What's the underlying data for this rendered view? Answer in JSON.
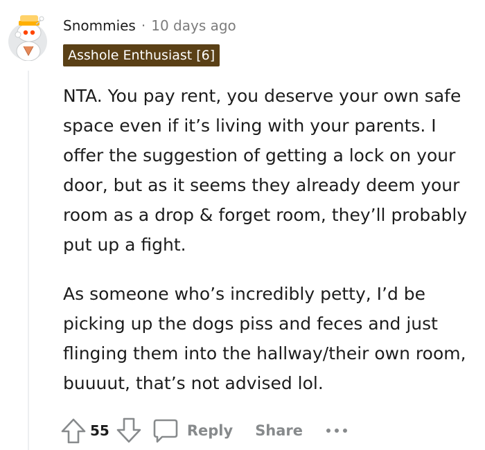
{
  "comment": {
    "username": "Snommies",
    "separator": "·",
    "timestamp": "10 days ago",
    "flair": "Asshole Enthusiast [6]",
    "paragraphs": [
      "NTA. You pay rent, you deserve your own safe space even if it’s living with your parents. I offer the suggestion of getting a lock on your door, but as it seems they already deem your room as a drop & forget room, they’ll probably put up a fight.",
      "As someone who’s incredibly petty, I’d be picking up the dogs piss and feces and just flinging them into the hallway/their own room, buuuut, that’s not advised lol."
    ]
  },
  "actions": {
    "vote_count": "55",
    "reply_label": "Reply",
    "share_label": "Share"
  },
  "icons": {
    "upvote": "upvote-arrow-icon",
    "downvote": "downvote-arrow-icon",
    "reply": "chat-bubble-icon",
    "more": "ellipsis-icon",
    "avatar": "snoo-avatar"
  },
  "colors": {
    "flair_background": "#5a4016",
    "flair_text": "#ffffff",
    "muted_text": "#878a8c",
    "body_text": "#1c1c1c",
    "thread_line": "#edeff1"
  }
}
